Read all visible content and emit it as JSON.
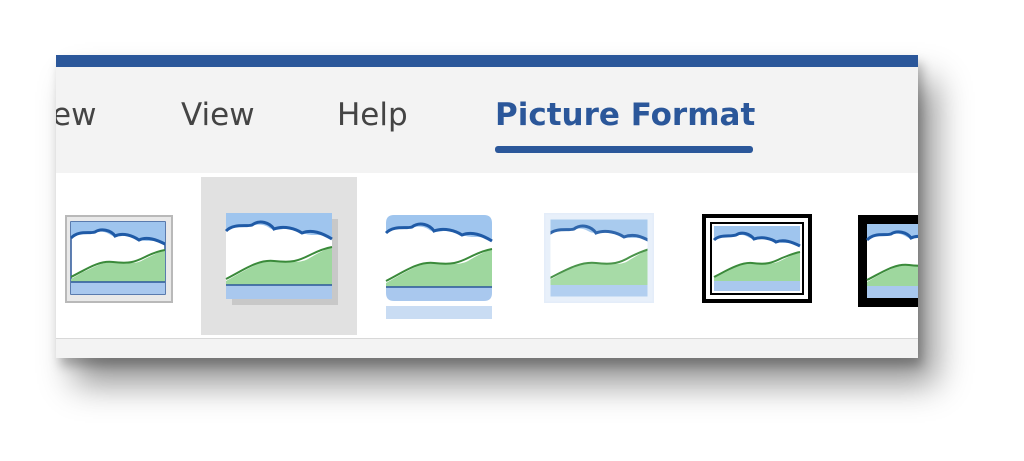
{
  "ribbon": {
    "tabs": [
      {
        "label": "ew",
        "active": false
      },
      {
        "label": "View",
        "active": false
      },
      {
        "label": "Help",
        "active": false
      },
      {
        "label": "Picture Format",
        "active": true
      }
    ],
    "accent_color": "#2b579a"
  },
  "picture_styles": {
    "items": [
      {
        "icon": "simple-frame-picture-icon",
        "selected": false
      },
      {
        "icon": "drop-shadow-picture-icon",
        "selected": true
      },
      {
        "icon": "rounded-reflection-picture-icon",
        "selected": false
      },
      {
        "icon": "soft-edge-picture-icon",
        "selected": false
      },
      {
        "icon": "double-frame-black-picture-icon",
        "selected": false
      },
      {
        "icon": "thick-black-frame-picture-icon",
        "selected": false
      }
    ]
  }
}
